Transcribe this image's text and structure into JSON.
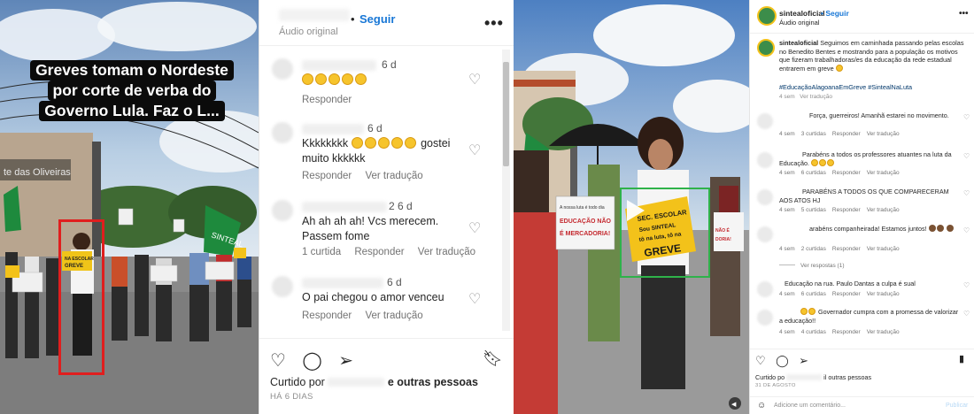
{
  "panel_video": {
    "caption_lines": [
      "Greves tomam o Nordeste",
      "por corte de verba do",
      "Governo Lula. Faz o L..."
    ],
    "building_sign": "te das Oliveiras",
    "protest_sign": "SINTEAL",
    "highlight_sign": "NA ESCOLAR TÔ NA LUTA GREVE"
  },
  "panel_comments": {
    "header": {
      "dot": "•",
      "follow_label": "Seguir",
      "audio_label": "Áudio original",
      "more_label": "•••"
    },
    "comments": [
      {
        "age": "6 d",
        "text": "",
        "emoji_count": 5,
        "actions": [
          "Responder"
        ]
      },
      {
        "age": "6 d",
        "text": "Kkkkkkkk",
        "emoji_count": 5,
        "text_after": "gostei muito kkkkkk",
        "actions": [
          "Responder",
          "Ver tradução"
        ]
      },
      {
        "age": "2 6 d",
        "text": "Ah ah ah ah! Vcs merecem. Passem fome",
        "actions": [
          "1 curtida",
          "Responder",
          "Ver tradução"
        ]
      },
      {
        "age": "6 d",
        "text": "O pai chegou o amor venceu",
        "actions": [
          "Responder",
          "Ver tradução"
        ]
      }
    ],
    "footer": {
      "liked_prefix": "Curtido por",
      "liked_suffix": "e outras pessoas",
      "date": "HÁ 6 DIAS"
    }
  },
  "panel_photo": {
    "sign_left": "A nossa luta é todo dia EDUCAÇÃO NÃO É MERCADORIA!",
    "sign_center": "SEC. ESCOLAR Sou SINTEAL tô na luta, tô na GREVE",
    "sign_right": "NÃO É DORIA!"
  },
  "panel_post": {
    "header": {
      "username": "sintealoficial",
      "follow_label": "• Seguir",
      "audio_label": "Áudio original",
      "more_label": "•••"
    },
    "caption": {
      "username": "sintealoficial",
      "text": "Seguimos em caminhada passando pelas escolas no Benedito Bentes e mostrando para a população os motivos que fizeram trabalhadoras/es da educação da rede estadual entrarem em greve",
      "hashtags": "#EducaçãoAlagoanaEmGreve #SintealNaLuta",
      "meta": [
        "4 sem",
        "Ver tradução"
      ]
    },
    "comments": [
      {
        "text": "Força, guerreiros! Amanhã estarei no movimento.",
        "meta": [
          "4 sem",
          "3 curtidas",
          "Responder",
          "Ver tradução"
        ]
      },
      {
        "text": "Parabéns a todos os professores atuantes na luta da Educação.",
        "emoji": 3,
        "meta": [
          "4 sem",
          "6 curtidas",
          "Responder",
          "Ver tradução"
        ]
      },
      {
        "text": "PARABÉNS A TODOS OS QUE COMPARECERAM AOS ATOS HJ",
        "meta": [
          "4 sem",
          "5 curtidas",
          "Responder",
          "Ver tradução"
        ]
      },
      {
        "text": "arabéns companheirada! Estamos juntos!",
        "emoji": 3,
        "meta": [
          "4 sem",
          "2 curtidas",
          "Responder",
          "Ver tradução"
        ]
      },
      {
        "text": "Educação na rua. Paulo Dantas a culpa é sual",
        "meta": [
          "4 sem",
          "6 curtidas",
          "Responder",
          "Ver tradução"
        ]
      },
      {
        "text": "Governador cumpra com a promessa de valorizar a educação!!",
        "emoji": 2,
        "meta": [
          "4 sem",
          "4 curtidas",
          "Responder",
          "Ver tradução"
        ]
      }
    ],
    "view_replies": "Ver respostas (1)",
    "footer": {
      "liked_prefix": "Curtido po",
      "liked_suffix": "il outras pessoas",
      "date": "31 DE AGOSTO"
    },
    "add_comment": {
      "placeholder": "Adicione um comentário...",
      "publish": "Publicar"
    }
  }
}
